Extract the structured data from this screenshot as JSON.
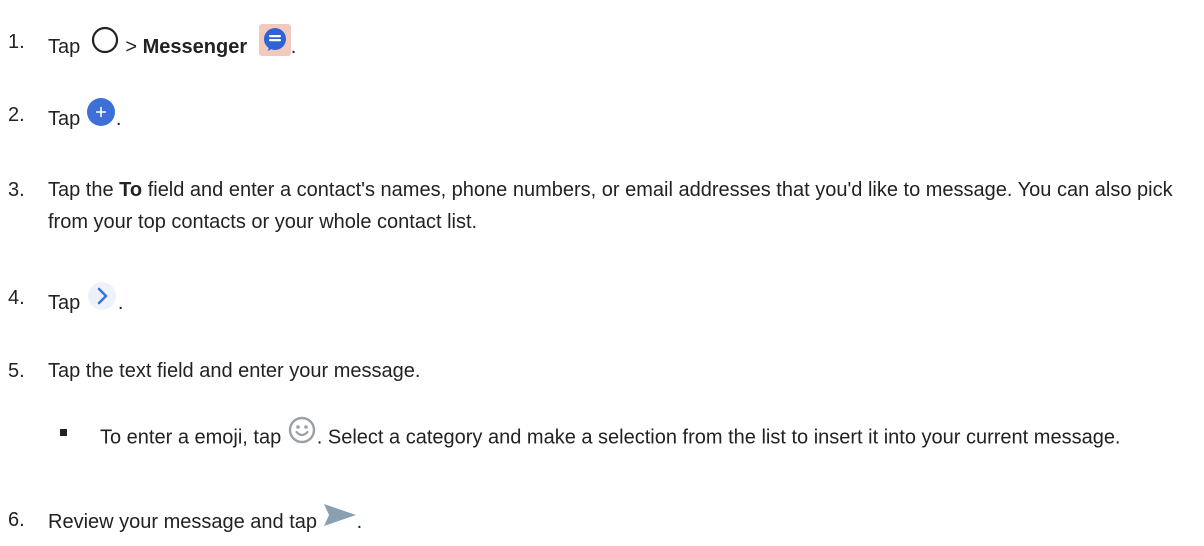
{
  "steps": [
    {
      "num": "1.",
      "pre": "Tap",
      "sep": ">",
      "bold": "Messenger",
      "post": ".",
      "icons": [
        "home-circle-icon",
        "messenger-app-icon"
      ]
    },
    {
      "num": "2.",
      "pre": "Tap",
      "post": ".",
      "icons": [
        "new-message-fab-icon"
      ]
    },
    {
      "num": "3.",
      "pre": "Tap the",
      "bold": "To",
      "post": "field and enter a contact's names, phone numbers, or email addresses that you'd like to message. You can also pick from your top contacts or your whole contact list."
    },
    {
      "num": "4.",
      "pre": "Tap",
      "post": ".",
      "icons": [
        "next-chevron-icon"
      ]
    },
    {
      "num": "5.",
      "text": "Tap the text field and enter your message."
    },
    {
      "num": "6.",
      "pre": "Review your message and tap",
      "post": ".",
      "icons": [
        "send-icon"
      ]
    }
  ],
  "sub_bullet": {
    "pre": "To enter a emoji, tap",
    "post": ". Select a category and make a selection from the list to insert it into your current message.",
    "icons": [
      "emoji-smiley-icon"
    ]
  },
  "colors": {
    "text": "#222222",
    "fab_blue": "#3d6fd9",
    "chevron_blue": "#3b73d6",
    "messenger_bg": "#f2c9bd",
    "messenger_blue": "#2d63d4",
    "emoji_gray": "#9aa0a6",
    "send_gray": "#8aa0b0"
  }
}
